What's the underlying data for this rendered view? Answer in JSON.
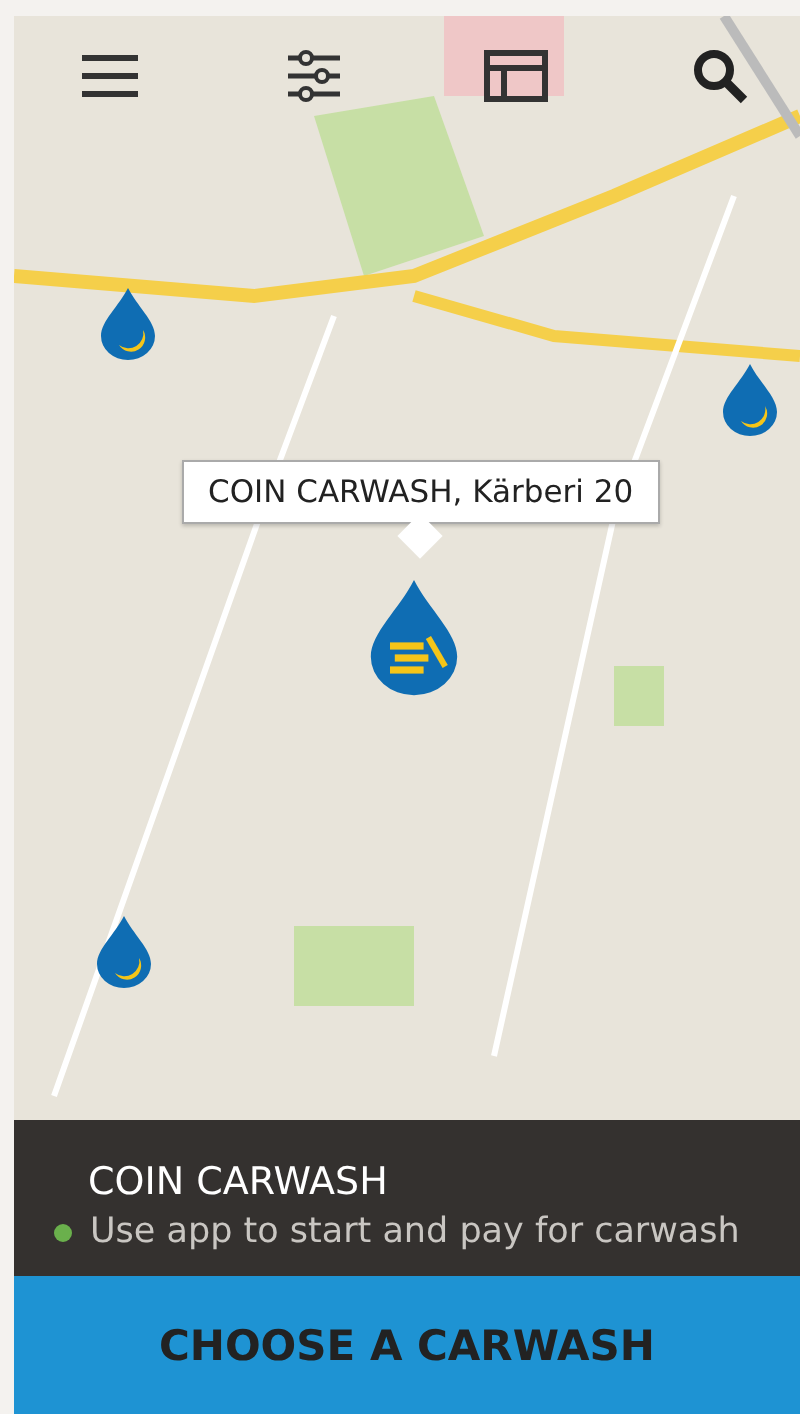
{
  "map": {
    "pins": [
      {
        "selected": false
      },
      {
        "selected": false
      },
      {
        "selected": true
      },
      {
        "selected": false
      }
    ],
    "popup": {
      "text": "COIN CARWASH, Kärberi 20"
    }
  },
  "info_panel": {
    "title": "COIN CARWASH",
    "status": {
      "text": "Use app to start and pay for carwash",
      "color": "#6ab04c"
    }
  },
  "action_button": {
    "label": "CHOOSE A CARWASH"
  }
}
